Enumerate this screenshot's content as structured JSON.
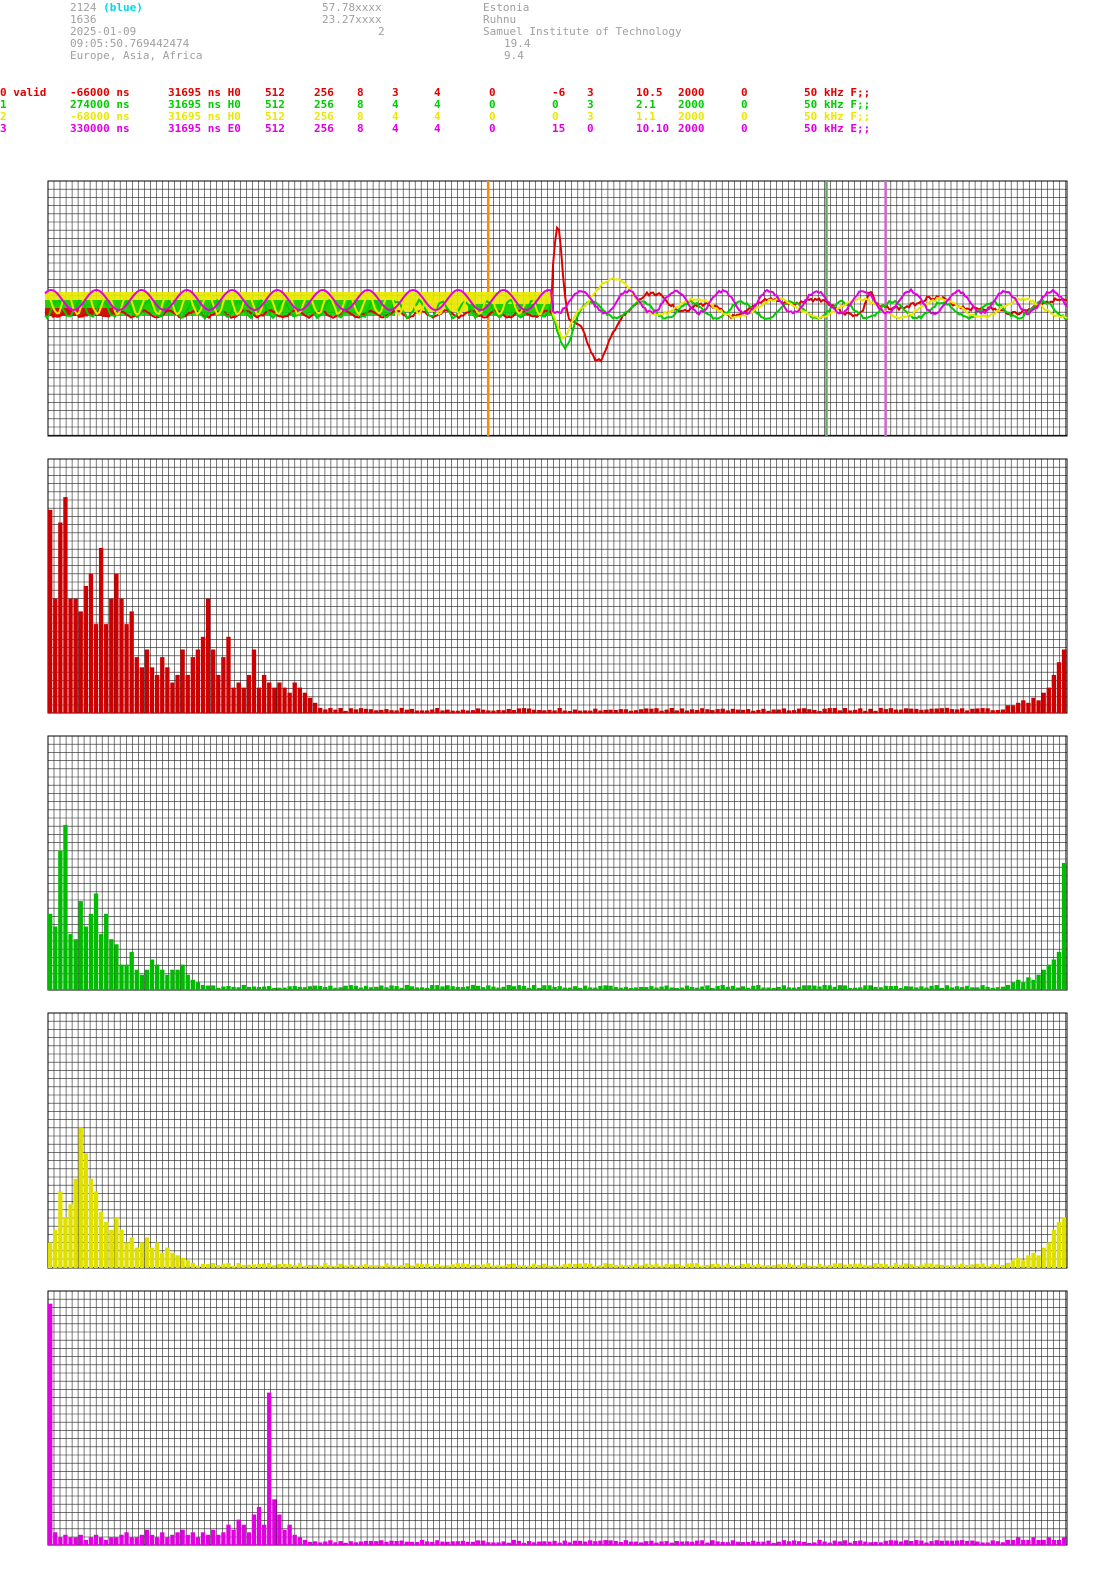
{
  "header": {
    "id": "2124",
    "id_tag": "(blue)",
    "number": "1636",
    "date": "2025-01-09",
    "time": "09:05:50.769442474",
    "region": "Europe, Asia, Africa",
    "lat": "57.78xxxx",
    "lon": "23.27xxxx",
    "count": "2",
    "country": "Estonia",
    "site": "Ruhnu",
    "institute": "Samuel Institute of Technology",
    "val1": "19.4",
    "val2": "9.4"
  },
  "channels": [
    {
      "label": "0 valid",
      "offset": "-66000 ns",
      "period": "31695 ns H0",
      "c1": "512",
      "c2": "256",
      "c3": "8",
      "c4": "3",
      "c5": "4",
      "c6": "0",
      "c7": "-6",
      "c8": "3",
      "c9": "10.5",
      "c10": "2000",
      "c11": "0",
      "freq": "50 kHz F;;",
      "color": "#e00000"
    },
    {
      "label": "1",
      "offset": "274000 ns",
      "period": "31695 ns H0",
      "c1": "512",
      "c2": "256",
      "c3": "8",
      "c4": "4",
      "c5": "4",
      "c6": "0",
      "c7": "0",
      "c8": "3",
      "c9": "2.1",
      "c10": "2000",
      "c11": "0",
      "freq": "50 kHz F;;",
      "color": "#00cc00"
    },
    {
      "label": "2",
      "offset": "-68000 ns",
      "period": "31695 ns H0",
      "c1": "512",
      "c2": "256",
      "c3": "8",
      "c4": "4",
      "c5": "4",
      "c6": "0",
      "c7": "0",
      "c8": "3",
      "c9": "1.1",
      "c10": "2000",
      "c11": "0",
      "freq": "50 kHz F;;",
      "color": "#e8e800"
    },
    {
      "label": "3",
      "offset": "330000 ns",
      "period": "31695 ns E0",
      "c1": "512",
      "c2": "256",
      "c3": "8",
      "c4": "4",
      "c5": "4",
      "c6": "0",
      "c7": "15",
      "c8": "0",
      "c9": "10.10",
      "c10": "2000",
      "c11": "0",
      "freq": "50 kHz E;;",
      "color": "#e000e0"
    }
  ],
  "chart_data": [
    {
      "type": "line",
      "title": "",
      "markers": [
        {
          "x": 0.432,
          "color": "#ff8800"
        },
        {
          "x": 0.764,
          "color": "#66aa66"
        },
        {
          "x": 0.822,
          "color": "#cc66cc"
        }
      ],
      "series": [
        {
          "color": "#e00000",
          "kind": "waveform-ch0"
        },
        {
          "color": "#00cc00",
          "kind": "waveform-ch1"
        },
        {
          "color": "#e8e800",
          "kind": "waveform-ch2"
        },
        {
          "color": "#e000e0",
          "kind": "waveform-ch3"
        }
      ],
      "grid": true
    },
    {
      "type": "bar",
      "color": "#cc0000",
      "grid": true,
      "head": [
        0.8,
        0.45,
        0.75,
        0.85,
        0.45,
        0.45,
        0.4,
        0.5,
        0.55,
        0.35,
        0.65,
        0.35,
        0.45,
        0.55,
        0.45,
        0.35,
        0.4,
        0.22,
        0.18,
        0.25,
        0.18,
        0.15,
        0.22,
        0.18,
        0.12,
        0.15,
        0.25,
        0.15,
        0.22,
        0.25,
        0.3,
        0.45,
        0.25,
        0.15,
        0.22,
        0.3,
        0.1,
        0.12,
        0.1,
        0.15,
        0.25,
        0.1,
        0.15,
        0.12,
        0.1,
        0.12,
        0.1,
        0.08,
        0.12,
        0.1,
        0.08,
        0.06,
        0.04,
        0.02
      ],
      "tail": [
        0.03,
        0.03,
        0.04,
        0.05,
        0.04,
        0.06,
        0.05,
        0.08,
        0.1,
        0.15,
        0.2,
        0.25
      ]
    },
    {
      "type": "bar",
      "color": "#00bb00",
      "grid": true,
      "head": [
        0.3,
        0.25,
        0.55,
        0.65,
        0.22,
        0.2,
        0.35,
        0.25,
        0.3,
        0.38,
        0.22,
        0.3,
        0.2,
        0.18,
        0.1,
        0.1,
        0.15,
        0.08,
        0.06,
        0.08,
        0.12,
        0.1,
        0.08,
        0.06,
        0.08,
        0.08,
        0.1,
        0.06,
        0.04,
        0.03,
        0.02
      ],
      "tail": [
        0.02,
        0.03,
        0.04,
        0.03,
        0.05,
        0.04,
        0.06,
        0.08,
        0.1,
        0.12,
        0.15,
        0.5
      ]
    },
    {
      "type": "bar",
      "color": "#e0e000",
      "grid": true,
      "head": [
        0.1,
        0.15,
        0.3,
        0.2,
        0.25,
        0.35,
        0.55,
        0.45,
        0.35,
        0.3,
        0.22,
        0.18,
        0.15,
        0.2,
        0.15,
        0.1,
        0.12,
        0.08,
        0.1,
        0.12,
        0.08,
        0.1,
        0.06,
        0.08,
        0.06,
        0.05,
        0.04,
        0.03,
        0.02
      ],
      "tail": [
        0.02,
        0.03,
        0.04,
        0.03,
        0.05,
        0.06,
        0.05,
        0.08,
        0.1,
        0.15,
        0.18,
        0.2
      ]
    },
    {
      "type": "bar",
      "color": "#e000e0",
      "grid": true,
      "head": [
        0.95,
        0.05,
        0.03,
        0.04,
        0.03,
        0.03,
        0.04,
        0.02,
        0.03,
        0.04,
        0.03,
        0.02,
        0.03,
        0.03,
        0.04,
        0.05,
        0.03,
        0.03,
        0.04,
        0.06,
        0.04,
        0.03,
        0.05,
        0.03,
        0.04,
        0.05,
        0.06,
        0.04,
        0.05,
        0.03,
        0.05,
        0.04,
        0.06,
        0.04,
        0.05,
        0.08,
        0.06,
        0.1,
        0.08,
        0.05,
        0.12,
        0.15,
        0.08,
        0.6,
        0.18,
        0.12,
        0.06,
        0.08,
        0.04,
        0.03,
        0.02
      ],
      "tail": [
        0.02,
        0.02,
        0.03,
        0.02,
        0.02,
        0.03,
        0.02,
        0.02,
        0.03,
        0.02,
        0.02,
        0.03
      ]
    }
  ]
}
